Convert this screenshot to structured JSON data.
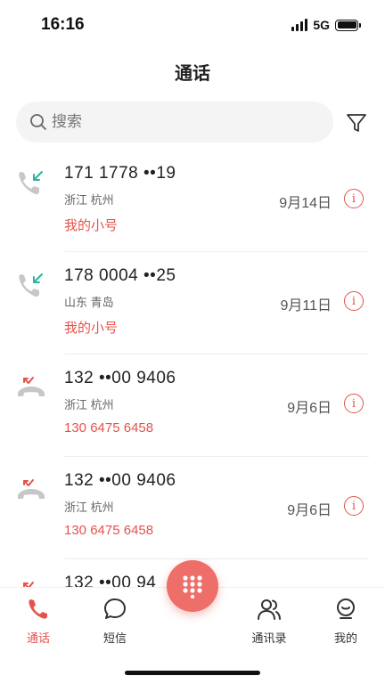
{
  "status_bar": {
    "time": "16:16",
    "network": "5G"
  },
  "header": {
    "title": "通话"
  },
  "search": {
    "placeholder": "搜索"
  },
  "calls": [
    {
      "type": "incoming",
      "number": "171 1778 ••19",
      "location": "浙江 杭州",
      "tag": "我的小号",
      "date": "9月14日"
    },
    {
      "type": "incoming",
      "number": "178 0004 ••25",
      "location": "山东 青岛",
      "tag": "我的小号",
      "date": "9月11日"
    },
    {
      "type": "missed",
      "number": "132 ••00 9406",
      "location": "浙江 杭州",
      "tag": "130 6475 6458",
      "date": "9月6日"
    },
    {
      "type": "missed",
      "number": "132 ••00 9406",
      "location": "浙江 杭州",
      "tag": "130 6475 6458",
      "date": "9月6日"
    },
    {
      "type": "missed",
      "number": "132 ••00 94",
      "location": "",
      "tag": "",
      "date": ""
    }
  ],
  "tabs": [
    {
      "label": "通话",
      "icon": "phone-icon",
      "active": true
    },
    {
      "label": "短信",
      "icon": "message-icon",
      "active": false
    },
    {
      "label": "通讯录",
      "icon": "contacts-icon",
      "active": false
    },
    {
      "label": "我的",
      "icon": "profile-icon",
      "active": false
    }
  ],
  "colors": {
    "accent": "#e5534b",
    "incoming": "#2bb59a",
    "dialpad": "#ee6e69"
  }
}
